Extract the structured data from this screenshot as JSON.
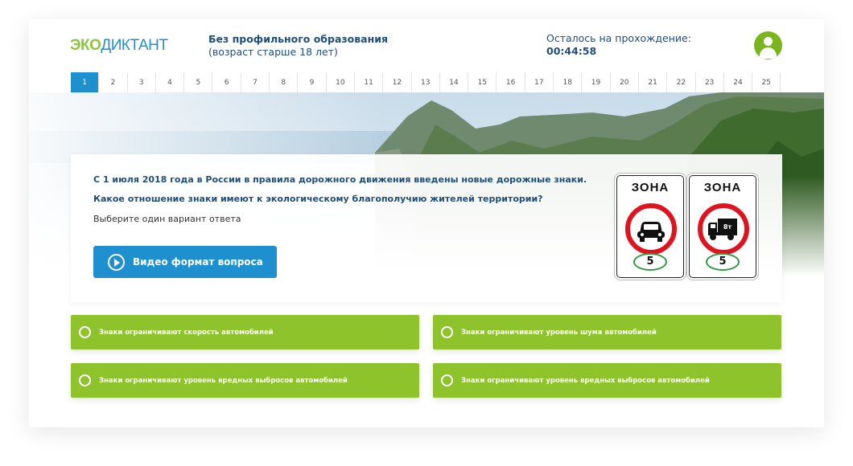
{
  "header": {
    "logo_part1": "ЭКО",
    "logo_part2": "ДИКТАНТ",
    "subtitle_line1": "Без профильного образования",
    "subtitle_line2": "(возраст старше 18 лет)",
    "timer_label": "Осталось на прохождение:",
    "timer_value": "00:44:58",
    "avatar_icon": "user-icon"
  },
  "question_nav": {
    "active": 1,
    "items": [
      "1",
      "2",
      "3",
      "4",
      "5",
      "6",
      "7",
      "8",
      "9",
      "10",
      "11",
      "12",
      "13",
      "14",
      "15",
      "16",
      "17",
      "18",
      "19",
      "20",
      "21",
      "22",
      "23",
      "24",
      "25"
    ]
  },
  "question": {
    "line1": "С 1 июля 2018 года в России в правила дорожного движения введены новые дорожные знаки.",
    "line2": "Какое отношение знаки имеют к экологическому благополучию жителей территории?",
    "hint": "Выберите один вариант ответа",
    "video_button": "Видео формат вопроса",
    "signs": [
      {
        "title": "ЗОНА",
        "vehicle": "car-icon",
        "speed": "5"
      },
      {
        "title": "ЗОНА",
        "vehicle": "truck-icon",
        "truck_label": "8т",
        "speed": "5"
      }
    ]
  },
  "answers": [
    "Знаки ограничивают скорость автомобилей",
    "Знаки ограничивают уровень шума автомобилей",
    "Знаки ограничивают уровень вредных выбросов автомобилей",
    "Знаки ограничивают уровень вредных выбросов автомобилей"
  ],
  "colors": {
    "accent_blue": "#1e8fcf",
    "answer_green": "#8fc32b",
    "text_dark_blue": "#1f4e79",
    "avatar_green": "#7ab51d"
  }
}
